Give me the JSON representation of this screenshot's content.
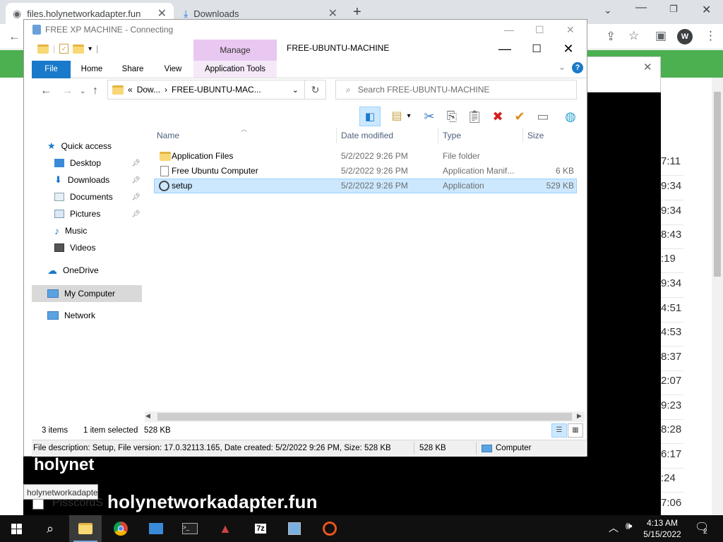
{
  "browser": {
    "tabs": [
      {
        "title": "files.holynetworkadapter.fun",
        "icon": "globe-icon"
      },
      {
        "title": "Downloads",
        "icon": "download-icon"
      }
    ],
    "new_tab": "+",
    "profile_initial": "W",
    "window_min": "⌄",
    "page_times": [
      "7:11",
      "9:34",
      "9:34",
      "8:43",
      ":19",
      "9:34",
      "4:51",
      "4:53",
      "8:37",
      "2:07",
      "9:23",
      "8:28",
      "6:17",
      ":24",
      "7:06"
    ],
    "accent_green": "#4caf50"
  },
  "overlay": {
    "brand_small": "holynet",
    "brand_large": "holynetworkadapter.fun",
    "tooltip": "holynetworkadapter",
    "bottom_row_text": "PisscordS"
  },
  "rdp": {
    "title": "FREE XP MACHINE - Connecting"
  },
  "explorer": {
    "window_title": "FREE-UBUNTU-MACHINE",
    "manage_label": "Manage",
    "ribbon_tabs": [
      "File",
      "Home",
      "Share",
      "View",
      "Application Tools"
    ],
    "address": {
      "prefix": "«",
      "crumbs": [
        "Dow...",
        "FREE-UBUNTU-MAC..."
      ]
    },
    "search_placeholder": "Search FREE-UBUNTU-MACHINE",
    "nav": [
      {
        "label": "Quick access",
        "icon": "star-icon"
      },
      {
        "label": "Desktop",
        "icon": "desktop-icon",
        "pinned": true
      },
      {
        "label": "Downloads",
        "icon": "download-arrow-icon",
        "pinned": true
      },
      {
        "label": "Documents",
        "icon": "documents-icon",
        "pinned": true
      },
      {
        "label": "Pictures",
        "icon": "pictures-icon",
        "pinned": true
      },
      {
        "label": "Music",
        "icon": "music-icon"
      },
      {
        "label": "Videos",
        "icon": "videos-icon"
      },
      {
        "label": "OneDrive",
        "icon": "cloud-icon"
      },
      {
        "label": "My Computer",
        "icon": "computer-icon",
        "selected": true
      },
      {
        "label": "Network",
        "icon": "network-icon"
      }
    ],
    "columns": [
      "Name",
      "Date modified",
      "Type",
      "Size"
    ],
    "files": [
      {
        "name": "Application Files",
        "date": "5/2/2022 9:26 PM",
        "type": "File folder",
        "size": "",
        "icon": "folder-icon"
      },
      {
        "name": "Free Ubuntu Computer",
        "date": "5/2/2022 9:26 PM",
        "type": "Application Manif...",
        "size": "6 KB",
        "icon": "manifest-icon"
      },
      {
        "name": "setup",
        "date": "5/2/2022 9:26 PM",
        "type": "Application",
        "size": "529 KB",
        "icon": "setup-icon",
        "selected": true
      }
    ],
    "status": {
      "items": "3 items",
      "selected": "1 item selected",
      "selected_size": "528 KB"
    },
    "details": {
      "description": "File description: Setup, File version: 17.0.32113.165, Date created: 5/2/2022 9:26 PM, Size: 528 KB",
      "size": "528 KB",
      "location": "Computer"
    }
  },
  "taskbar": {
    "time": "4:13 AM",
    "date": "5/15/2022",
    "notification_count": "2",
    "pinned_icons": [
      "folder-icon",
      "chrome-icon",
      "cmd-icon",
      "ubuntu-icon"
    ]
  }
}
